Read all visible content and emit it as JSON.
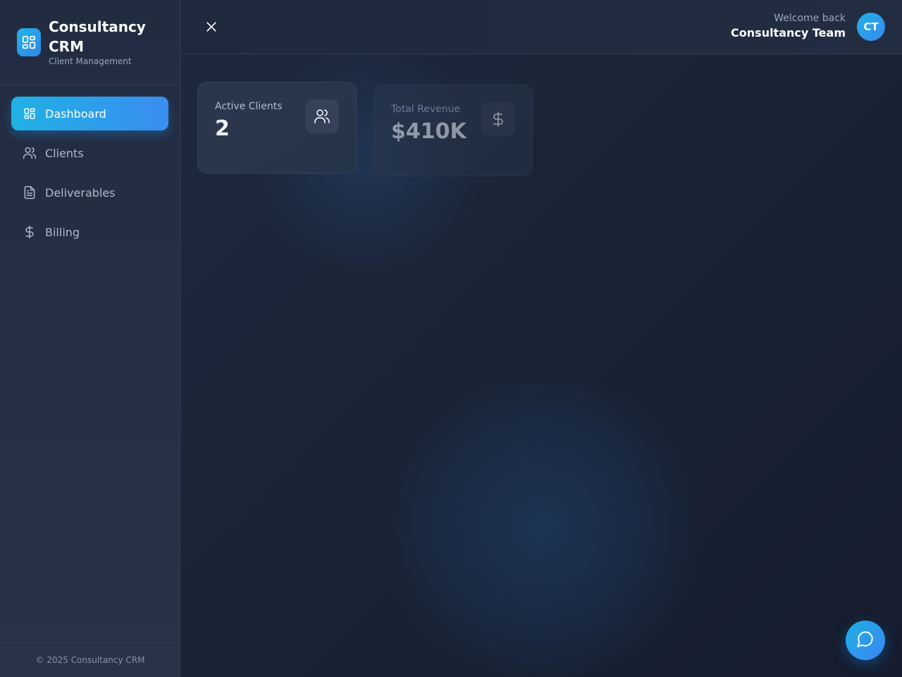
{
  "brand": {
    "title": "Consultancy CRM",
    "subtitle": "Client Management",
    "logo_icon": "dashboard-grid-icon"
  },
  "sidebar": {
    "items": [
      {
        "label": "Dashboard",
        "icon": "dashboard-grid-icon",
        "active": true
      },
      {
        "label": "Clients",
        "icon": "users-icon",
        "active": false
      },
      {
        "label": "Deliverables",
        "icon": "document-icon",
        "active": false
      },
      {
        "label": "Billing",
        "icon": "dollar-icon",
        "active": false
      }
    ],
    "footer": "© 2025 Consultancy CRM"
  },
  "header": {
    "close_icon": "close-icon",
    "welcome_label": "Welcome back",
    "user_name": "Consultancy Team",
    "avatar_initials": "CT"
  },
  "stats": [
    {
      "label": "Active Clients",
      "value": "2",
      "icon": "users-icon"
    },
    {
      "label": "Total Revenue",
      "value": "$410K",
      "icon": "dollar-icon"
    }
  ],
  "chat": {
    "icon": "chat-bubble-icon"
  },
  "colors": {
    "accent": "#1fb1e3",
    "accent_2": "#3a8df0",
    "background": "#1b2538",
    "sidebar": "#242e43",
    "text_primary": "#ffffff",
    "text_muted": "#9aa6b9"
  }
}
